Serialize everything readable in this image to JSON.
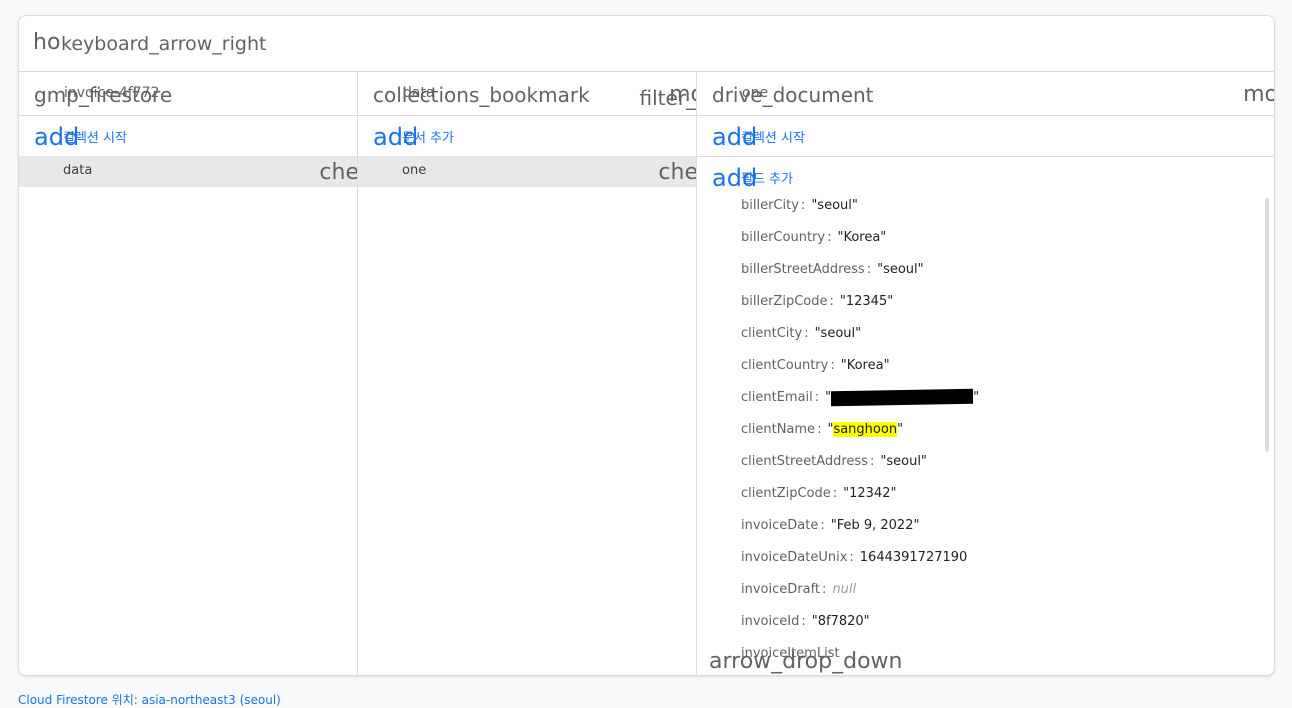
{
  "topbar": {
    "home_icon_text": "ho",
    "breadcrumb_text": "keyboard_arrow_right"
  },
  "columns": [
    {
      "header_icon": "gmp_firestore",
      "header_title": "invoice-4f772",
      "action": {
        "icon": "add",
        "label": "컬렉션 시작"
      },
      "rows": [
        {
          "label": "data",
          "chevron": "che"
        }
      ]
    },
    {
      "header_icon": "collections_bookmark",
      "header_title": "data",
      "header_filter": "filter_",
      "header_more": "mo",
      "action": {
        "icon": "add",
        "label": "문서 추가"
      },
      "rows": [
        {
          "label": "one",
          "chevron": "che"
        }
      ]
    },
    {
      "header_icon": "drive_document",
      "header_title": "one",
      "header_more": "mo",
      "actions": [
        {
          "icon": "add",
          "label": "컬렉션 시작"
        },
        {
          "icon": "add",
          "label": "필드 추가"
        }
      ],
      "fields": [
        {
          "key": "billerCity",
          "value": "\"seoul\""
        },
        {
          "key": "billerCountry",
          "value": "\"Korea\""
        },
        {
          "key": "billerStreetAddress",
          "value": "\"seoul\""
        },
        {
          "key": "billerZipCode",
          "value": "\"12345\""
        },
        {
          "key": "clientCity",
          "value": "\"seoul\""
        },
        {
          "key": "clientCountry",
          "value": "\"Korea\""
        },
        {
          "key": "clientEmail",
          "value": "\"",
          "value_after": "\""
        },
        {
          "key": "clientName",
          "value": "\"",
          "highlight": "sanghoon",
          "value_after": "\""
        },
        {
          "key": "clientStreetAddress",
          "value": "\"seoul\""
        },
        {
          "key": "clientZipCode",
          "value": "\"12342\""
        },
        {
          "key": "invoiceDate",
          "value": "\"Feb 9, 2022\""
        },
        {
          "key": "invoiceDateUnix",
          "value": "1644391727190"
        },
        {
          "key": "invoiceDraft",
          "value": "null"
        },
        {
          "key": "invoiceId",
          "value": "\"8f7820\""
        },
        {
          "key": "invoiceItemList",
          "value": ""
        }
      ],
      "dropdown_icon": "arrow_drop_down"
    }
  ],
  "footer": "Cloud Firestore 위치: asia-northeast3 (seoul)",
  "colors": {
    "accent": "#1a73e8",
    "highlight": "#ffff00",
    "selected_row": "#e8e8e8"
  }
}
